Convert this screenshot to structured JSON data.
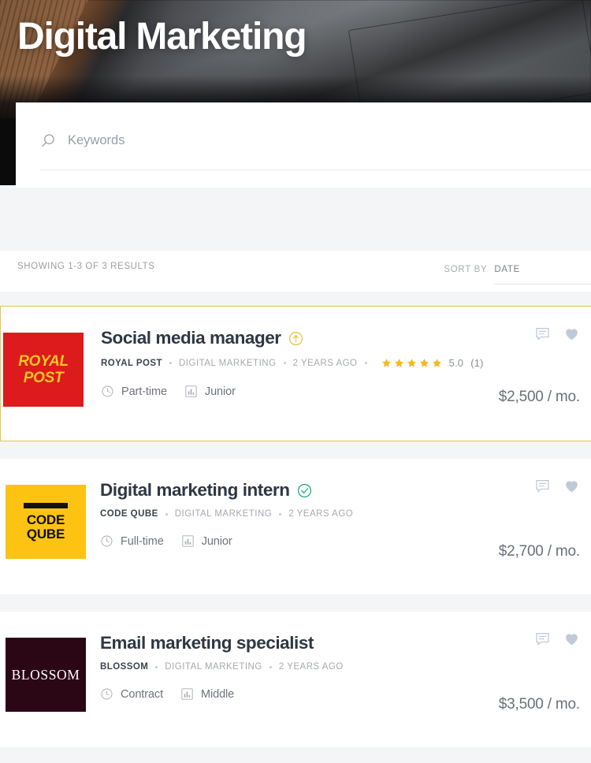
{
  "hero": {
    "title": "Digital Marketing",
    "background": "blurred-laptop-on-wooden-desk"
  },
  "search": {
    "icon": "search-icon",
    "placeholder": "Keywords",
    "value": ""
  },
  "results_bar": {
    "count_text": "SHOWING 1-3 OF 3 RESULTS",
    "sort_label": "SORT BY",
    "sort_value": "DATE"
  },
  "colors": {
    "featured_border": "#e8c44b",
    "badge_featured": "#e8c44b",
    "badge_verified": "#26b07a",
    "star": "#f5b921",
    "title": "#2f3744",
    "heart": "#c2cad8",
    "page_bg": "#f4f5f6"
  },
  "jobs": [
    {
      "title": "Social media manager",
      "badge": "featured-arrow-up-icon",
      "company": "ROYAL POST",
      "category": "DIGITAL MARKETING",
      "posted": "2 YEARS AGO",
      "rating": {
        "stars": 5,
        "value": "5.0",
        "count": "(1)"
      },
      "type": "Part-time",
      "level": "Junior",
      "salary": "$2,500 / mo.",
      "featured": true,
      "logo": {
        "style": "royal",
        "line1": "ROYAL",
        "line2": "POST",
        "bg": "#dd1a1c",
        "fg": "#ffc425"
      },
      "actions": {
        "comment": "comment-icon",
        "favorite": "heart-icon"
      }
    },
    {
      "title": "Digital marketing intern",
      "badge": "verified-check-icon",
      "company": "CODE QUBE",
      "category": "DIGITAL MARKETING",
      "posted": "2 YEARS AGO",
      "rating": null,
      "type": "Full-time",
      "level": "Junior",
      "salary": "$2,700 / mo.",
      "featured": false,
      "logo": {
        "style": "code",
        "line1": "CODE",
        "line2": "QUBE",
        "bg": "#fcc312",
        "fg": "#111111"
      },
      "actions": {
        "comment": "comment-icon",
        "favorite": "heart-icon"
      }
    },
    {
      "title": "Email marketing specialist",
      "badge": null,
      "company": "BLOSSOM",
      "category": "DIGITAL MARKETING",
      "posted": "2 YEARS AGO",
      "rating": null,
      "type": "Contract",
      "level": "Middle",
      "salary": "$3,500 / mo.",
      "featured": false,
      "logo": {
        "style": "blossom",
        "line1": "BLOSSOM",
        "line2": "",
        "bg": "#2b0716",
        "fg": "#ffffff"
      },
      "actions": {
        "comment": "comment-icon",
        "favorite": "heart-icon"
      }
    }
  ]
}
